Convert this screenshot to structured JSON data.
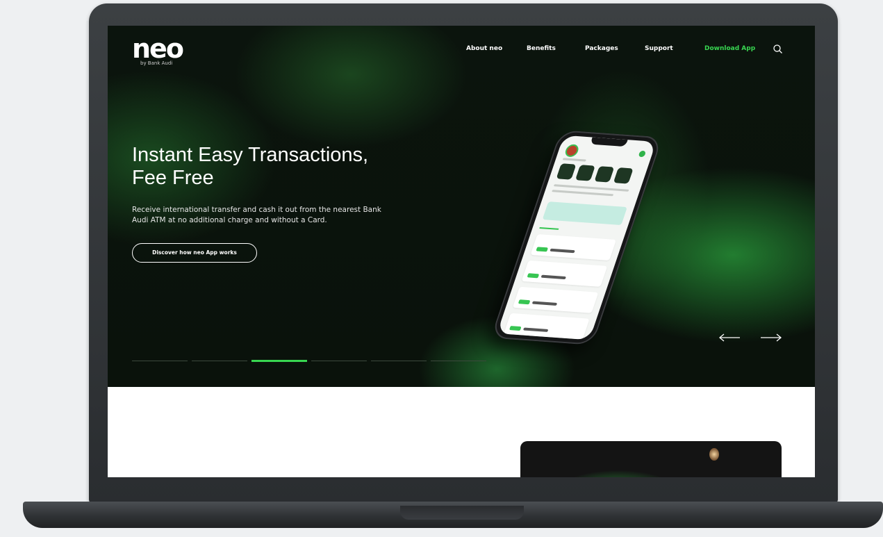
{
  "brand": {
    "logo": "neo",
    "tagline": "by Bank Audi"
  },
  "nav": {
    "items": [
      {
        "label": "About neo"
      },
      {
        "label": "Benefits"
      },
      {
        "label": "Packages"
      },
      {
        "label": "Support"
      },
      {
        "label": "Download App"
      }
    ],
    "search_icon": "search-icon"
  },
  "hero": {
    "headline_line1": "Instant Easy Transactions,",
    "headline_line2": "Fee Free",
    "body_line1": "Receive international transfer and cash it out from the nearest Bank",
    "body_line2": "Audi ATM at no additional charge and without a Card.",
    "cta_label": "Discover how neo App works",
    "slides_total": 6,
    "active_slide": 3,
    "prev_icon": "arrow-left-icon",
    "next_icon": "arrow-right-icon"
  },
  "colors": {
    "accent": "#38d651",
    "hero_bg": "#0a120b",
    "laptop": "#2e3134",
    "page_bg": "#eef0f2"
  }
}
